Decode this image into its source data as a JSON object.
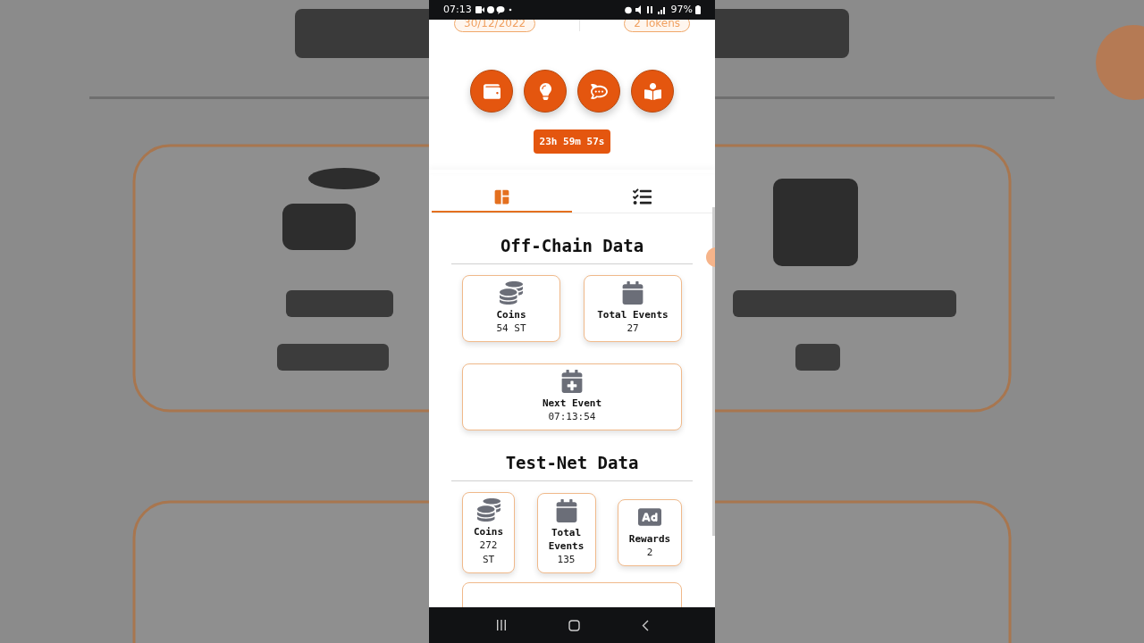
{
  "status_bar": {
    "time": "07:13",
    "battery": "97%"
  },
  "header": {
    "date": "30/12/2022",
    "tokens": "2 Tokens"
  },
  "timer": "23h 59m 57s",
  "tabs": [
    {
      "kind": "dashboard",
      "selected": true
    },
    {
      "kind": "checklist",
      "selected": false
    }
  ],
  "sections": [
    {
      "title": "Off-Chain Data",
      "rows": [
        [
          {
            "kind": "coins",
            "label": "Coins",
            "value": "54 ST"
          },
          {
            "kind": "calendar",
            "label": "Total Events",
            "value": "27"
          }
        ],
        [
          {
            "kind": "calendar-plus",
            "label": "Next Event",
            "value": "07:13:54"
          }
        ]
      ]
    },
    {
      "title": "Test-Net Data",
      "rows": [
        [
          {
            "kind": "coins",
            "label": "Coins",
            "value": "272 ST"
          },
          {
            "kind": "calendar",
            "label": "Total Events",
            "value": "135"
          },
          {
            "kind": "ad",
            "label": "Rewards",
            "value": "2"
          }
        ]
      ]
    }
  ]
}
